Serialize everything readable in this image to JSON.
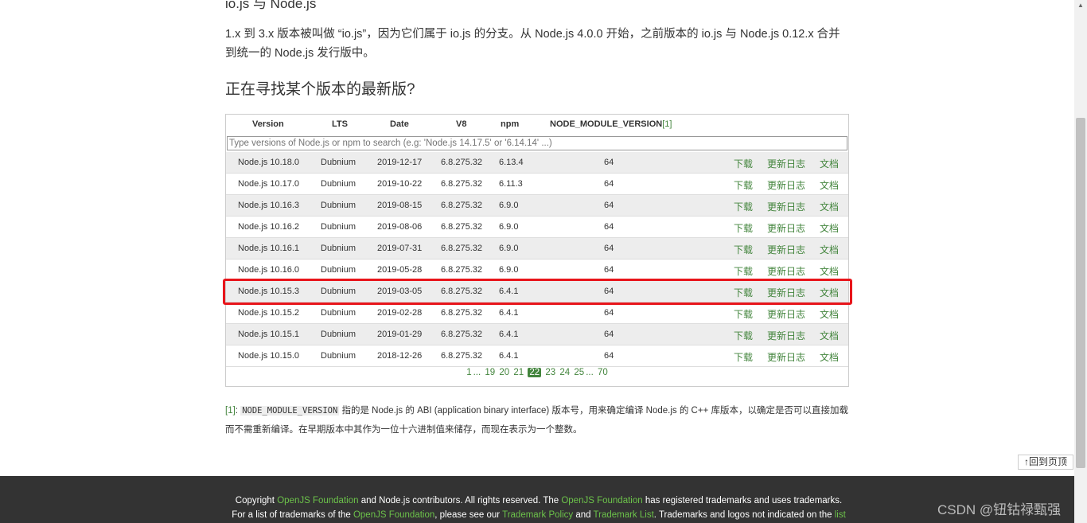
{
  "page": {
    "heading_cut": "io.js 与 Node.js",
    "paragraph": "1.x 到 3.x 版本被叫做 “io.js”，因为它们属于 io.js 的分支。从 Node.js 4.0.0 开始，之前版本的 io.js 与 Node.js 0.12.x 合并到统一的 Node.js 发行版中。",
    "section_title": "正在寻找某个版本的最新版?"
  },
  "table": {
    "headers": {
      "version": "Version",
      "lts": "LTS",
      "date": "Date",
      "v8": "V8",
      "npm": "npm",
      "nmv": "NODE_MODULE_VERSION",
      "nmv_ref": "[1]"
    },
    "search_placeholder": "Type versions of Node.js or npm to search (e.g: 'Node.js 14.17.5' or '6.14.14' ...)",
    "link_download": "下载",
    "link_changelog": "更新日志",
    "link_docs": "文档",
    "rows": [
      {
        "version": "Node.js 10.18.0",
        "lts": "Dubnium",
        "date": "2019-12-17",
        "v8": "6.8.275.32",
        "npm": "6.13.4",
        "nmv": "64"
      },
      {
        "version": "Node.js 10.17.0",
        "lts": "Dubnium",
        "date": "2019-10-22",
        "v8": "6.8.275.32",
        "npm": "6.11.3",
        "nmv": "64"
      },
      {
        "version": "Node.js 10.16.3",
        "lts": "Dubnium",
        "date": "2019-08-15",
        "v8": "6.8.275.32",
        "npm": "6.9.0",
        "nmv": "64"
      },
      {
        "version": "Node.js 10.16.2",
        "lts": "Dubnium",
        "date": "2019-08-06",
        "v8": "6.8.275.32",
        "npm": "6.9.0",
        "nmv": "64"
      },
      {
        "version": "Node.js 10.16.1",
        "lts": "Dubnium",
        "date": "2019-07-31",
        "v8": "6.8.275.32",
        "npm": "6.9.0",
        "nmv": "64"
      },
      {
        "version": "Node.js 10.16.0",
        "lts": "Dubnium",
        "date": "2019-05-28",
        "v8": "6.8.275.32",
        "npm": "6.9.0",
        "nmv": "64"
      },
      {
        "version": "Node.js 10.15.3",
        "lts": "Dubnium",
        "date": "2019-03-05",
        "v8": "6.8.275.32",
        "npm": "6.4.1",
        "nmv": "64"
      },
      {
        "version": "Node.js 10.15.2",
        "lts": "Dubnium",
        "date": "2019-02-28",
        "v8": "6.8.275.32",
        "npm": "6.4.1",
        "nmv": "64"
      },
      {
        "version": "Node.js 10.15.1",
        "lts": "Dubnium",
        "date": "2019-01-29",
        "v8": "6.8.275.32",
        "npm": "6.4.1",
        "nmv": "64"
      },
      {
        "version": "Node.js 10.15.0",
        "lts": "Dubnium",
        "date": "2018-12-26",
        "v8": "6.8.275.32",
        "npm": "6.4.1",
        "nmv": "64"
      }
    ],
    "pagination": {
      "first": "1",
      "ellipsis1": "...",
      "pages_before": [
        "19",
        "20",
        "21"
      ],
      "current": "22",
      "pages_after": [
        "23",
        "24",
        "25"
      ],
      "ellipsis2": "...",
      "last": "70"
    }
  },
  "footnote": {
    "ref": "[1]",
    "colon": ": ",
    "code": "NODE_MODULE_VERSION",
    "text": " 指的是 Node.js 的 ABI (application binary interface) 版本号，用来确定编译 Node.js 的 C++ 库版本，以确定是否可以直接加载而不需重新编译。在早期版本中其作为一位十六进制值来储存，而现在表示为一个整数。"
  },
  "back_to_top": "↑回到页顶",
  "footer": {
    "l1_a": "Copyright ",
    "l1_b": "OpenJS Foundation",
    "l1_c": " and Node.js contributors. All rights reserved. The ",
    "l1_d": "OpenJS Foundation",
    "l1_e": " has registered trademarks and uses trademarks.",
    "l2_a": "For a list of trademarks of the ",
    "l2_b": "OpenJS Foundation",
    "l2_c": ", please see our ",
    "l2_d": "Trademark Policy",
    "l2_e": " and ",
    "l2_f": "Trademark List",
    "l2_g": ". Trademarks and logos not indicated on the ",
    "l2_h": "list"
  },
  "watermark": "CSDN @钮钴禄甄强",
  "colors": {
    "accent_green": "#43853d",
    "highlight_red": "#e8151b",
    "footer_bg": "#333333"
  }
}
